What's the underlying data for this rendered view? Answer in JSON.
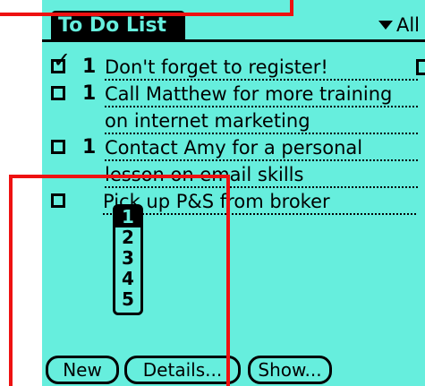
{
  "title": "To Do List",
  "category": "All",
  "tasks": [
    {
      "checked": true,
      "priority": "1",
      "lines": [
        "Don't forget to register!"
      ],
      "note": true
    },
    {
      "checked": false,
      "priority": "1",
      "lines": [
        "Call Matthew for more training",
        "on internet marketing"
      ],
      "note": false
    },
    {
      "checked": false,
      "priority": "1",
      "lines": [
        "Contact Amy for a personal",
        "lesson on email skills"
      ],
      "note": false
    },
    {
      "checked": false,
      "priority": "1",
      "lines": [
        "Pick up P&S from broker"
      ],
      "note": false
    }
  ],
  "priority_popup": {
    "options": [
      "1",
      "2",
      "3",
      "4",
      "5"
    ],
    "selected": "1"
  },
  "buttons": {
    "new": "New",
    "details": "Details...",
    "show": "Show..."
  },
  "colors": {
    "screen": "#66eedd",
    "highlight": "#ee1111"
  }
}
